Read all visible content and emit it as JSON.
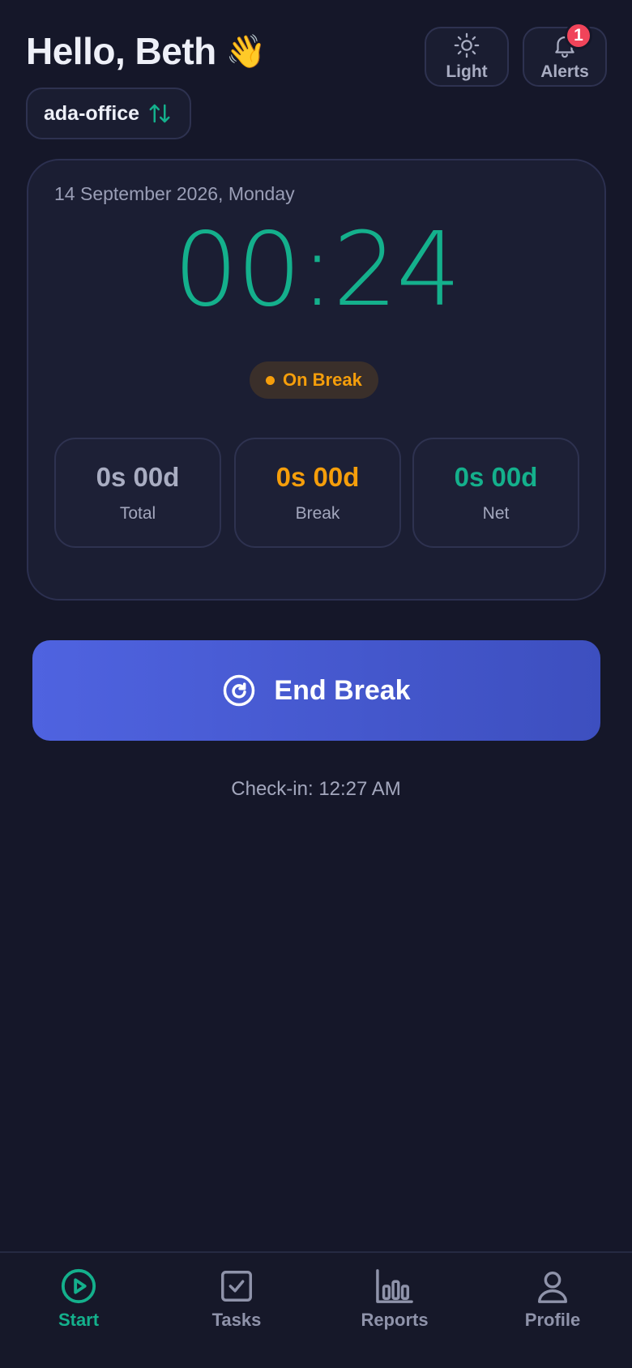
{
  "header": {
    "greeting": "Hello, Beth",
    "wave_emoji": "👋",
    "theme_label": "Light",
    "alerts_label": "Alerts",
    "alerts_count": "1"
  },
  "office": {
    "name": "ada-office",
    "icon": "swap-vertical-icon"
  },
  "timer_card": {
    "date": "14 September 2026, Monday",
    "time": "00:24",
    "status": "On Break",
    "stats": [
      {
        "value": "0s 00d",
        "label": "Total",
        "color": "#a9adc2"
      },
      {
        "value": "0s 00d",
        "label": "Break",
        "color": "#f59e0b"
      },
      {
        "value": "0s 00d",
        "label": "Net",
        "color": "#14b08c"
      }
    ]
  },
  "action": {
    "label": "End Break",
    "icon": "restart-icon"
  },
  "checkin": "Check-in: 12:27 AM",
  "nav": [
    {
      "label": "Start",
      "icon": "play-circle-icon",
      "active": true
    },
    {
      "label": "Tasks",
      "icon": "checkbox-icon",
      "active": false
    },
    {
      "label": "Reports",
      "icon": "bar-chart-icon",
      "active": false
    },
    {
      "label": "Profile",
      "icon": "user-icon",
      "active": false
    }
  ],
  "colors": {
    "accent": "#14b08c",
    "warning": "#f59e0b",
    "primary": "#4f63e0",
    "background": "#151729",
    "badge": "#f0445a"
  }
}
